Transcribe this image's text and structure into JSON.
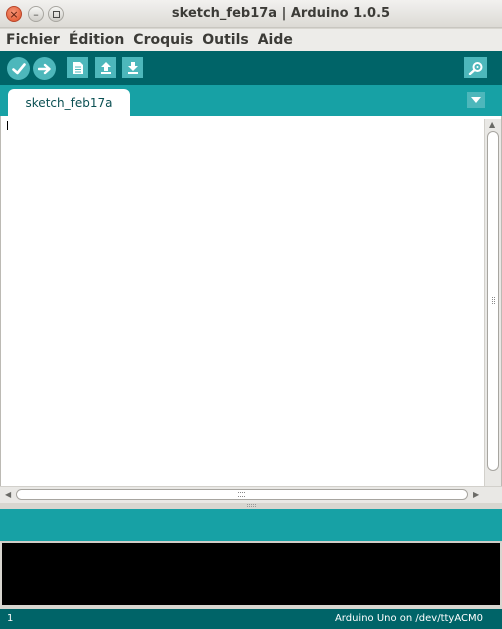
{
  "window": {
    "title": "sketch_feb17a | Arduino 1.0.5",
    "close_glyph": "×",
    "minimize_glyph": "–"
  },
  "menubar": {
    "items": [
      "Fichier",
      "Édition",
      "Croquis",
      "Outils",
      "Aide"
    ]
  },
  "toolbar": {
    "buttons": [
      "verify-icon",
      "upload-icon",
      "new-icon",
      "open-icon",
      "save-icon"
    ],
    "right_button": "serial-monitor-icon",
    "button_color": "#4db7bb",
    "icon_color": "#ffffff",
    "background": "#006468"
  },
  "tabs": {
    "items": [
      {
        "label": "sketch_feb17a"
      }
    ],
    "menu_icon": "triangle-down-icon",
    "background": "#17a1a5"
  },
  "editor": {
    "content": ""
  },
  "status": {
    "line": "1",
    "board": "Arduino Uno on /dev/ttyACM0"
  }
}
